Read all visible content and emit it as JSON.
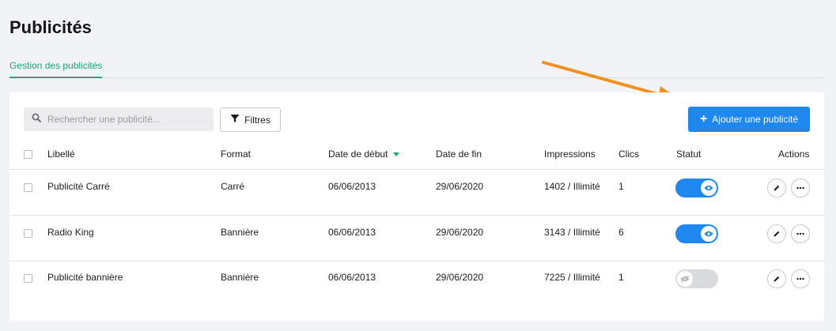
{
  "page": {
    "title": "Publicités"
  },
  "tabs": [
    {
      "label": "Gestion des publicités",
      "active": true
    }
  ],
  "toolbar": {
    "search_placeholder": "Rechercher une publicité...",
    "filter_label": "Filtres",
    "add_label": "Ajouter une publicité"
  },
  "table": {
    "columns": {
      "label": "Libellé",
      "format": "Format",
      "start": "Date de début",
      "end": "Date de fin",
      "impressions": "Impressions",
      "clicks": "Clics",
      "status": "Statut",
      "actions": "Actions"
    },
    "rows": [
      {
        "label": "Publicité Carré",
        "format": "Carré",
        "start": "06/06/2013",
        "end": "29/06/2020",
        "impressions": "1402 / Illimité",
        "clicks": "1",
        "active": true
      },
      {
        "label": "Radio King",
        "format": "Bannière",
        "start": "06/06/2013",
        "end": "29/06/2020",
        "impressions": "3143 / Illimité",
        "clicks": "6",
        "active": true
      },
      {
        "label": "Publicité bannière",
        "format": "Bannière",
        "start": "06/06/2013",
        "end": "29/06/2020",
        "impressions": "7225 / Illimité",
        "clicks": "1",
        "active": false
      }
    ]
  },
  "colors": {
    "accent": "#1e87f0",
    "tab_active": "#1ba57a",
    "arrow": "#f5901e"
  },
  "icons": {
    "search": "search-icon",
    "filter": "filter-icon",
    "add": "plus-icon",
    "sort": "sort-down-icon",
    "eye": "eye-icon",
    "eye_off": "eye-off-icon",
    "edit": "pencil-icon",
    "more": "more-icon"
  }
}
